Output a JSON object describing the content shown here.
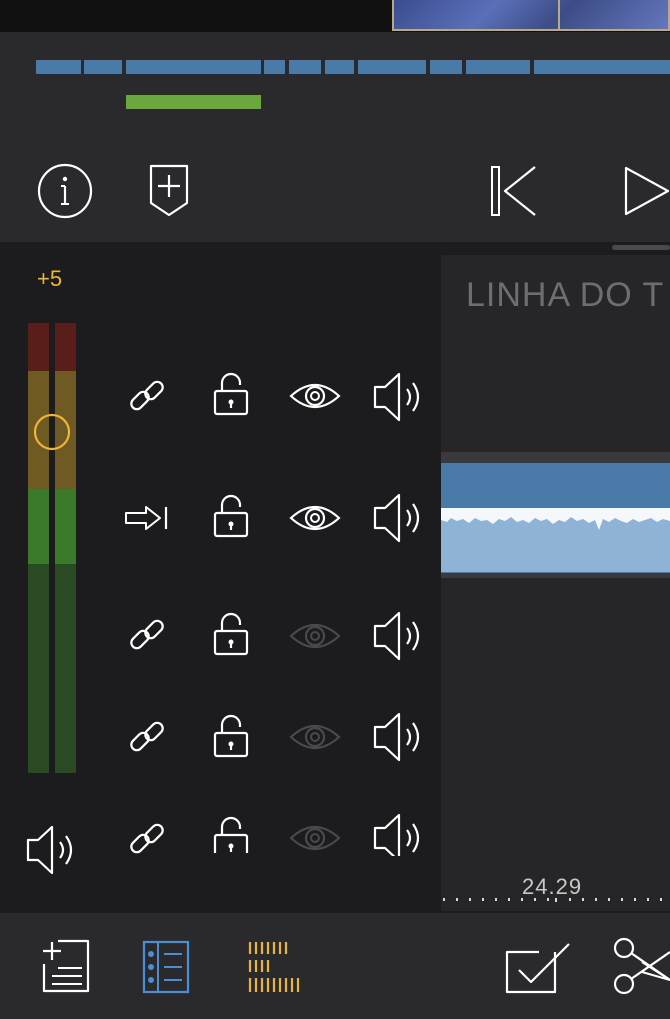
{
  "overview": {
    "segment_color": "#4a7aa8",
    "marker_color": "#6aa83e"
  },
  "toolbar": {
    "icons": [
      "info-icon",
      "add-marker-icon",
      "skip-to-start-icon",
      "play-icon"
    ]
  },
  "meter": {
    "level_label": "+5",
    "label_color": "#f0b43c"
  },
  "tracks": [
    {
      "row": 1,
      "link": "link-icon",
      "lock": "unlocked",
      "visible": true,
      "audio": true
    },
    {
      "row": 2,
      "link": "arrow-to-end-icon",
      "lock": "unlocked",
      "visible": true,
      "audio": true
    },
    {
      "row": 3,
      "link": "link-icon",
      "lock": "unlocked",
      "visible": false,
      "audio": true
    },
    {
      "row": 4,
      "link": "link-icon",
      "lock": "unlocked",
      "visible": false,
      "audio": true
    },
    {
      "row": 5,
      "link": "link-icon",
      "lock": "unlocked",
      "visible": false,
      "audio": true
    }
  ],
  "timeline": {
    "title": "LINHA DO T",
    "timecode": "24.29",
    "clip_color": "#4a7aa8"
  },
  "bottom_toolbar": {
    "icons": [
      "add-list-icon",
      "list-view-icon",
      "grid-view-icon",
      "check-icon",
      "scissors-icon"
    ],
    "active_color": "#4a8fd4",
    "grid_color": "#e8b43c"
  }
}
